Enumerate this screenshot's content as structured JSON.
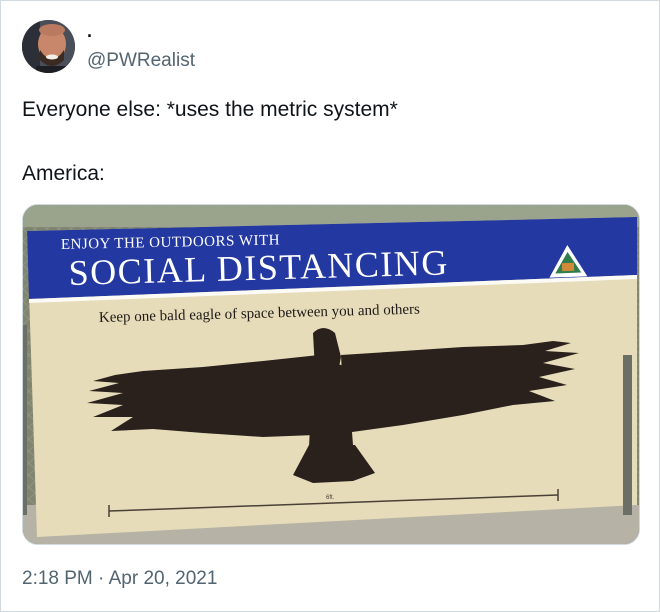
{
  "tweet": {
    "display_name": ".",
    "handle": "@PWRealist",
    "text_line1": "Everyone else: *uses the metric system*",
    "text_line2": "America:",
    "timestamp": "2:18 PM · Apr 20, 2021"
  },
  "media": {
    "sign_header": "Enjoy the outdoors with",
    "sign_title": "Social Distancing",
    "sign_subtitle": "Keep one bald eagle of space between you and others",
    "measure_label": "6ft."
  },
  "colors": {
    "sign_blue": "#2338a0",
    "sign_tan": "#e7dcb9",
    "eagle": "#2a211d",
    "text_secondary": "#536471"
  },
  "icons": {
    "avatar": "profile-photo",
    "park_logo": "triangle-logo"
  }
}
